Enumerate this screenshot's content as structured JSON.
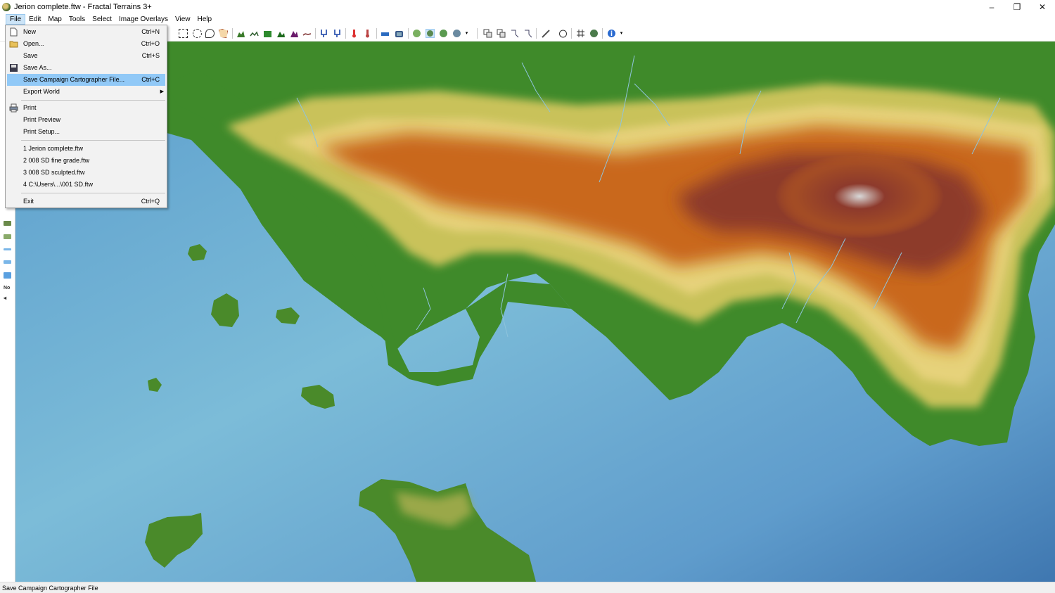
{
  "window": {
    "title": "Jerion complete.ftw - Fractal Terrains 3+",
    "minimize": "–",
    "restore": "❐",
    "close": "✕"
  },
  "menubar": {
    "items": [
      "File",
      "Edit",
      "Map",
      "Tools",
      "Select",
      "Image Overlays",
      "View",
      "Help"
    ],
    "active": "File"
  },
  "file_menu": {
    "new": {
      "label": "New",
      "shortcut": "Ctrl+N"
    },
    "open": {
      "label": "Open...",
      "shortcut": "Ctrl+O"
    },
    "save": {
      "label": "Save",
      "shortcut": "Ctrl+S"
    },
    "save_as": {
      "label": "Save As..."
    },
    "save_cc": {
      "label": "Save Campaign Cartographer File...",
      "shortcut": "Ctrl+C"
    },
    "export_world": {
      "label": "Export World"
    },
    "print": {
      "label": "Print"
    },
    "print_preview": {
      "label": "Print Preview"
    },
    "print_setup": {
      "label": "Print Setup..."
    },
    "recent": [
      "1 Jerion complete.ftw",
      "2 008 SD fine grade.ftw",
      "3 008 SD sculpted.ftw",
      "4 C:\\Users\\...\\001 SD.ftw"
    ],
    "exit": {
      "label": "Exit",
      "shortcut": "Ctrl+Q"
    }
  },
  "leftbar": {
    "label": "No",
    "arrow": "◂"
  },
  "status": {
    "text": "Save Campaign Cartographer File"
  },
  "colors": {
    "ocean_deep": "#3f77b0",
    "ocean_shallow": "#7cbcd8",
    "lowland": "#3f8a2a",
    "midland": "#e6d27a",
    "highland": "#c9681c",
    "peak": "#8d3a2c",
    "snow": "#d8d8d8",
    "menu_highlight": "#91c9f7"
  }
}
